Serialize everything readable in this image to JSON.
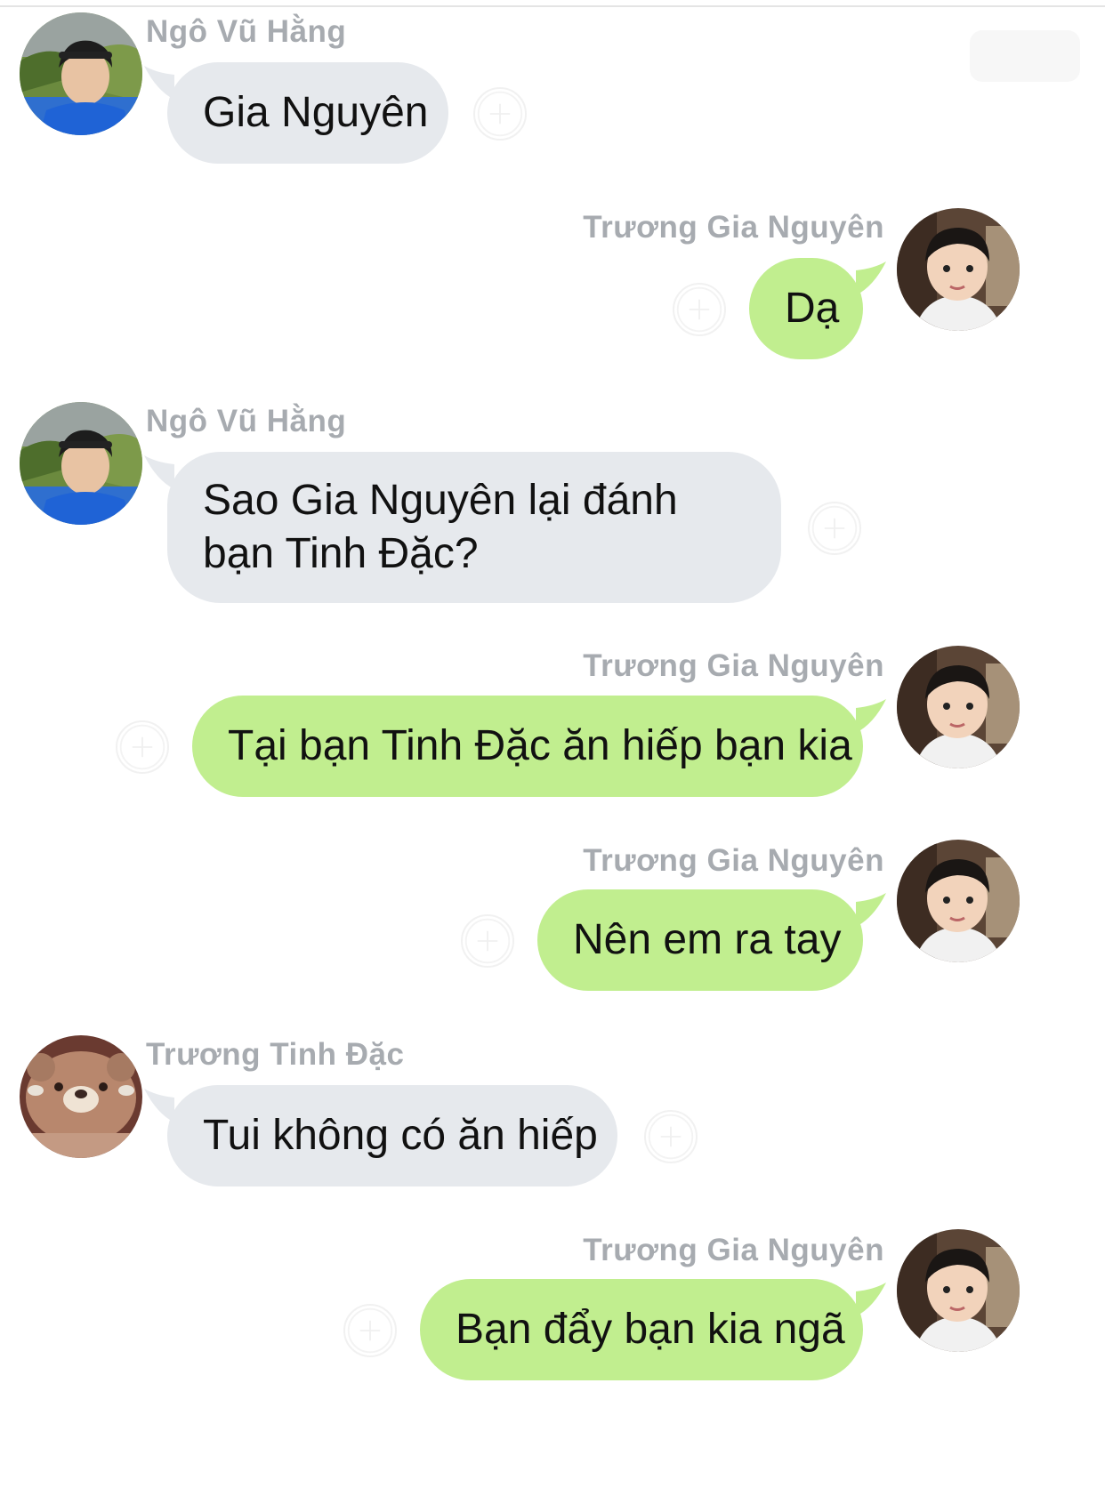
{
  "chat": {
    "participants": {
      "hang": "Ngô Vũ Hằng",
      "nguyen": "Trương Gia Nguyên",
      "dac": "Trương Tinh Đặc"
    },
    "messages": [
      {
        "sender": "Ngô Vũ Hằng",
        "text": "Gia Nguyên",
        "side": "incoming"
      },
      {
        "sender": "Trương Gia Nguyên",
        "text": "Dạ",
        "side": "outgoing"
      },
      {
        "sender": "Ngô Vũ Hằng",
        "text": "Sao Gia Nguyên lại đánh bạn Tinh Đặc?",
        "side": "incoming"
      },
      {
        "sender": "Trương Gia Nguyên",
        "text": "Tại bạn Tinh Đặc ăn hiếp bạn kia",
        "side": "outgoing"
      },
      {
        "sender": "Trương Gia Nguyên",
        "text": "Nên em ra tay",
        "side": "outgoing"
      },
      {
        "sender": "Trương Tinh Đặc",
        "text": "Tui không có ăn hiếp",
        "side": "incoming"
      },
      {
        "sender": "Trương Gia Nguyên",
        "text": "Bạn đẩy bạn kia ngã",
        "side": "outgoing"
      }
    ]
  },
  "colors": {
    "incoming_bubble": "#e6e9ed",
    "outgoing_bubble": "#c1ee8f",
    "sender_name": "#a7abb0"
  },
  "icons": {
    "reaction": "add-reaction-icon"
  }
}
